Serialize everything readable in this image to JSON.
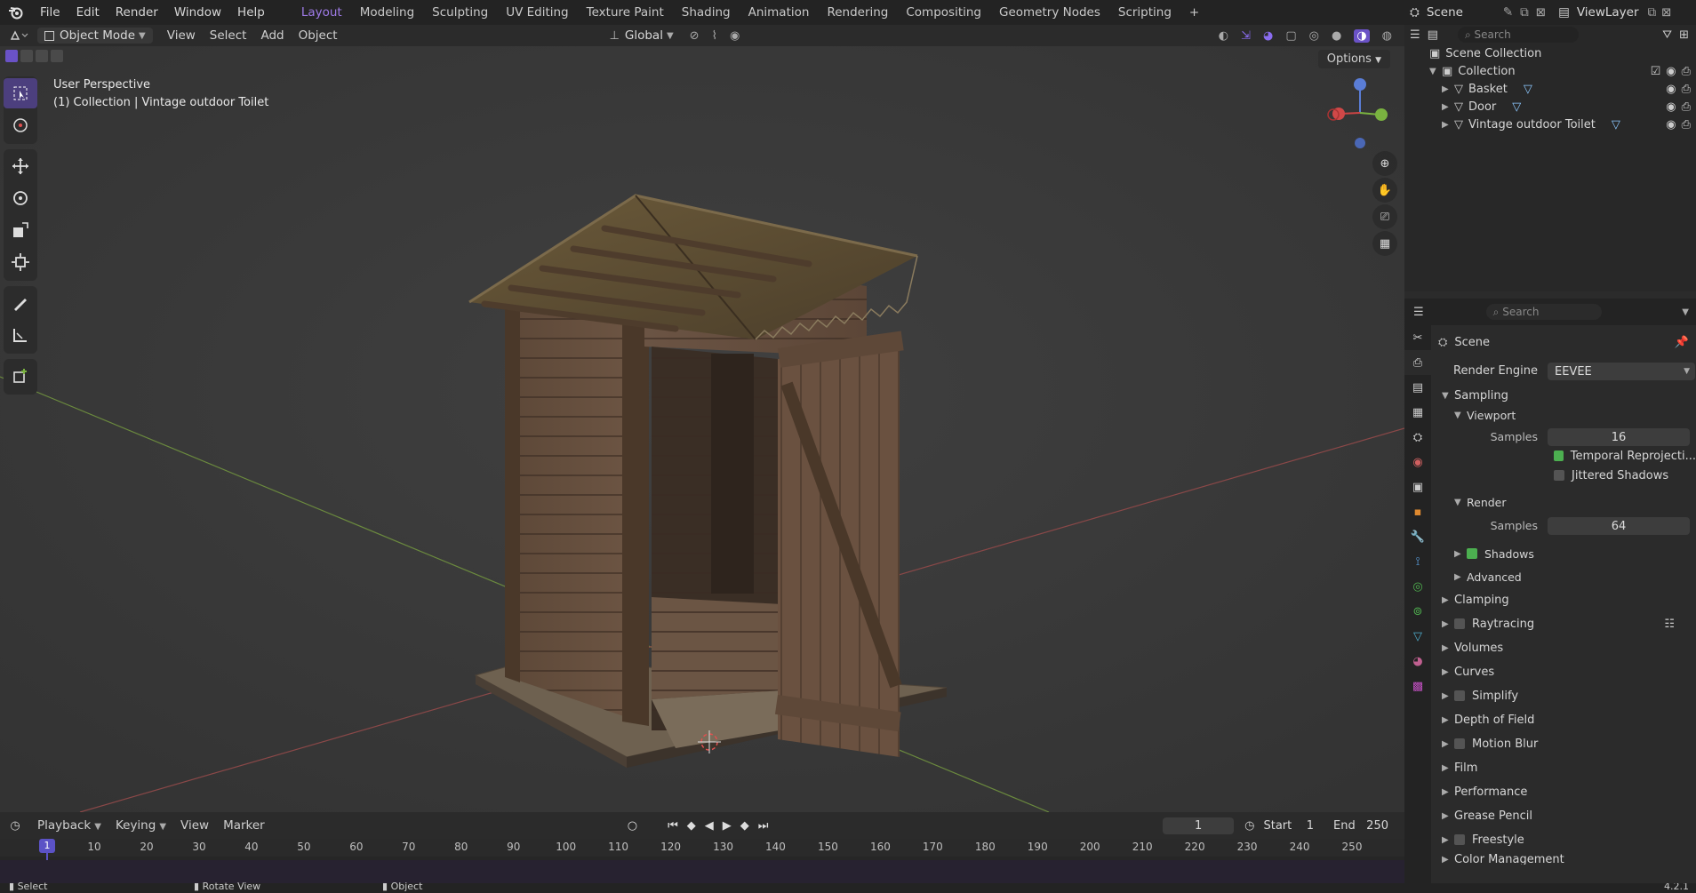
{
  "topbar": {
    "menus": [
      "File",
      "Edit",
      "Render",
      "Window",
      "Help"
    ],
    "workspaces": [
      "Layout",
      "Modeling",
      "Sculpting",
      "UV Editing",
      "Texture Paint",
      "Shading",
      "Animation",
      "Rendering",
      "Compositing",
      "Geometry Nodes",
      "Scripting"
    ],
    "active_workspace": "Layout",
    "add_tab": "+",
    "scene_label": "Scene",
    "viewlayer_label": "ViewLayer"
  },
  "viewport_header": {
    "mode": "Object Mode",
    "menus": [
      "View",
      "Select",
      "Add",
      "Object"
    ],
    "orientation": "Global",
    "options": "Options"
  },
  "viewport": {
    "perspective": "User Perspective",
    "context": "(1) Collection | Vintage outdoor Toilet",
    "gizmo_axis": "Z",
    "accent": "#8a6cf0"
  },
  "outliner": {
    "search_placeholder": "Search",
    "root": "Scene Collection",
    "collection": "Collection",
    "objects": [
      "Basket",
      "Door",
      "Vintage outdoor Toilet"
    ]
  },
  "properties": {
    "search_placeholder": "Search",
    "scene_label": "Scene",
    "render_engine_label": "Render Engine",
    "render_engine_value": "EEVEE",
    "sampling": "Sampling",
    "viewport": "Viewport",
    "samples_label": "Samples",
    "viewport_samples": "16",
    "temporal_reprojection": "Temporal Reprojecti...",
    "jittered_shadows": "Jittered Shadows",
    "render": "Render",
    "render_samples": "64",
    "shadows": "Shadows",
    "advanced": "Advanced",
    "sections": [
      "Clamping",
      "Raytracing",
      "Volumes",
      "Curves",
      "Simplify",
      "Depth of Field",
      "Motion Blur",
      "Film",
      "Performance",
      "Grease Pencil",
      "Freestyle",
      "Color Management"
    ]
  },
  "timeline": {
    "menus": [
      "Playback",
      "Keying",
      "View",
      "Marker"
    ],
    "current_frame": "1",
    "start_label": "Start",
    "start_value": "1",
    "end_label": "End",
    "end_value": "250",
    "ticks": [
      "1",
      "10",
      "20",
      "30",
      "40",
      "50",
      "60",
      "70",
      "80",
      "90",
      "100",
      "110",
      "120",
      "130",
      "140",
      "150",
      "160",
      "170",
      "180",
      "190",
      "200",
      "210",
      "220",
      "230",
      "240",
      "250"
    ]
  },
  "statusbar": {
    "select": "Select",
    "rotate": "Rotate View",
    "object": "Object",
    "version": "4.2.1"
  }
}
